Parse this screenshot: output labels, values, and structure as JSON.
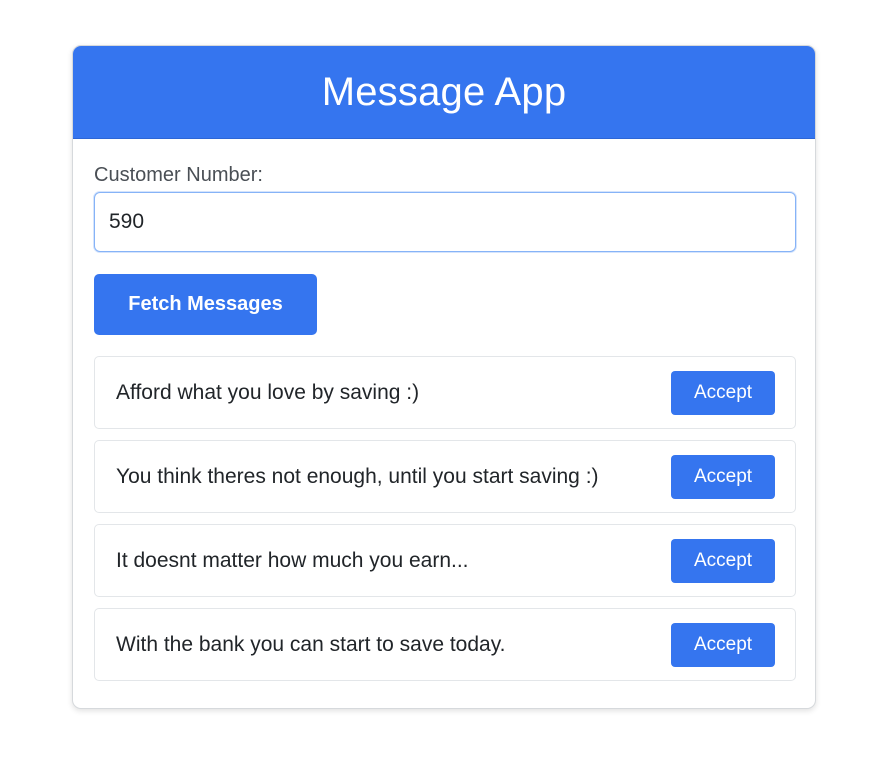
{
  "app": {
    "title": "Message App"
  },
  "form": {
    "label": "Customer Number:",
    "value": "590",
    "fetch_label": "Fetch Messages"
  },
  "messages": [
    {
      "text": "Afford what you love by saving :)",
      "action": "Accept"
    },
    {
      "text": "You think theres not enough, until you start saving :)",
      "action": "Accept"
    },
    {
      "text": "It doesnt matter how much you earn...",
      "action": "Accept"
    },
    {
      "text": "With the bank you can start to save today.",
      "action": "Accept"
    }
  ],
  "colors": {
    "primary": "#3575ef",
    "header_text": "#ffffff"
  }
}
